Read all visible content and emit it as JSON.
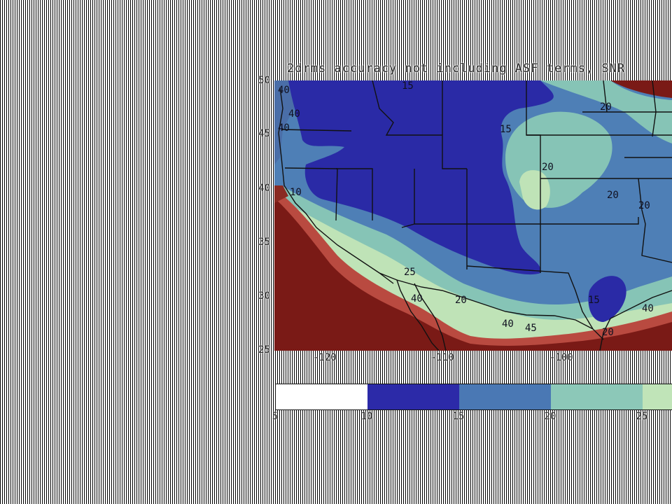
{
  "title": "2drms accuracy not including ASF terms, SNR",
  "map": {
    "y_ticks": [
      "50",
      "45",
      "40",
      "35",
      "30",
      "25"
    ],
    "x_ticks": [
      "-120",
      "-110",
      "-100"
    ],
    "contour_labels": [
      "15",
      "20",
      "15",
      "20",
      "20",
      "20",
      "10",
      "40",
      "40",
      "25",
      "40",
      "20",
      "40",
      "45",
      "15",
      "40",
      "20",
      "40"
    ]
  },
  "colorbar": {
    "ticks": [
      "5",
      "10",
      "15",
      "20",
      "25"
    ],
    "colors": [
      "#ffffff",
      "#2c2aa8",
      "#4a78b4",
      "#8cc8b8",
      "#c0e4b8"
    ]
  },
  "colors": {
    "deep_blue": "#2a2aa6",
    "steel_blue": "#4e7fb6",
    "teal": "#86c4b6",
    "pale_green": "#bfe3b7",
    "dark_red": "#7a1a16",
    "red_edge": "#b94a40"
  }
}
